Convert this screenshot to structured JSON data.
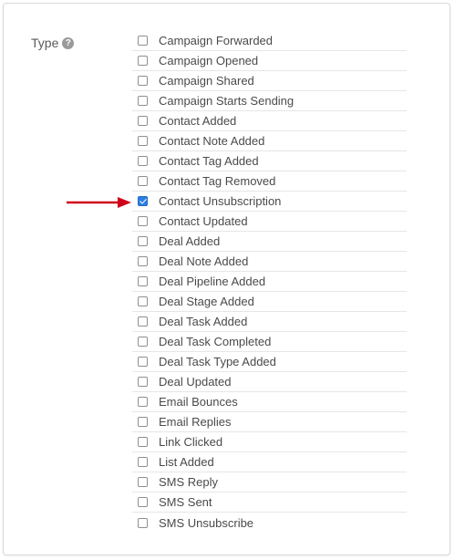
{
  "type_field": {
    "label": "Type",
    "help_icon_glyph": "?"
  },
  "types": [
    {
      "label": "Campaign Forwarded",
      "checked": false
    },
    {
      "label": "Campaign Opened",
      "checked": false
    },
    {
      "label": "Campaign Shared",
      "checked": false
    },
    {
      "label": "Campaign Starts Sending",
      "checked": false
    },
    {
      "label": "Contact Added",
      "checked": false
    },
    {
      "label": "Contact Note Added",
      "checked": false
    },
    {
      "label": "Contact Tag Added",
      "checked": false
    },
    {
      "label": "Contact Tag Removed",
      "checked": false
    },
    {
      "label": "Contact Unsubscription",
      "checked": true
    },
    {
      "label": "Contact Updated",
      "checked": false
    },
    {
      "label": "Deal Added",
      "checked": false
    },
    {
      "label": "Deal Note Added",
      "checked": false
    },
    {
      "label": "Deal Pipeline Added",
      "checked": false
    },
    {
      "label": "Deal Stage Added",
      "checked": false
    },
    {
      "label": "Deal Task Added",
      "checked": false
    },
    {
      "label": "Deal Task Completed",
      "checked": false
    },
    {
      "label": "Deal Task Type Added",
      "checked": false
    },
    {
      "label": "Deal Updated",
      "checked": false
    },
    {
      "label": "Email Bounces",
      "checked": false
    },
    {
      "label": "Email Replies",
      "checked": false
    },
    {
      "label": "Link Clicked",
      "checked": false
    },
    {
      "label": "List Added",
      "checked": false
    },
    {
      "label": "SMS Reply",
      "checked": false
    },
    {
      "label": "SMS Sent",
      "checked": false
    },
    {
      "label": "SMS Unsubscribe",
      "checked": false
    }
  ],
  "annotation": {
    "pointer_icon": "red-arrow-icon",
    "target_index": 8,
    "color": "#d0021b"
  },
  "colors": {
    "checkbox_checked": "#2d7fe0",
    "row_divider": "#e6e6e6"
  }
}
